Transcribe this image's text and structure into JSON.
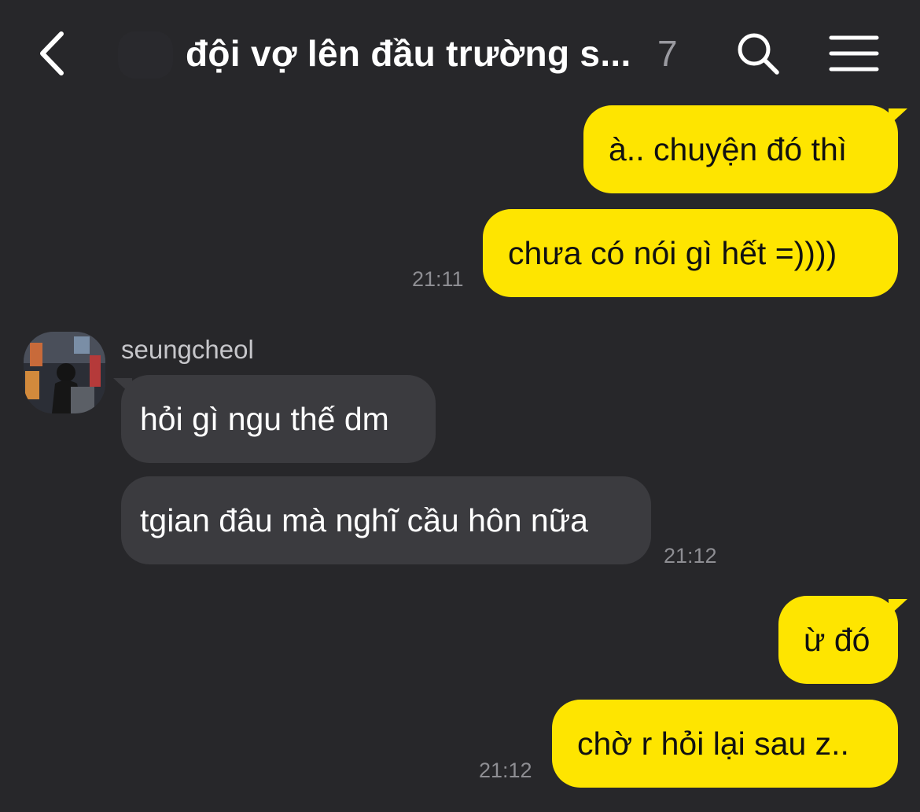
{
  "header": {
    "title": "đội vợ lên đầu trường s...",
    "member_count": "7",
    "back_icon": "chevron-left-icon",
    "search_icon": "search-icon",
    "menu_icon": "hamburger-menu-icon"
  },
  "messages": [
    {
      "sender": "me",
      "text": "à.. chuyện đó thì"
    },
    {
      "sender": "me",
      "text": "chưa có nói gì hết =))))",
      "time": "21:11"
    },
    {
      "sender": "seungcheol",
      "text": "hỏi gì ngu thế dm"
    },
    {
      "sender": "seungcheol",
      "text": "tgian đâu mà nghĩ cầu hôn nữa",
      "time": "21:12"
    },
    {
      "sender": "me",
      "text": "ừ đó"
    },
    {
      "sender": "me",
      "text": "chờ r hỏi lại sau z..",
      "time": "21:12"
    }
  ],
  "other_user": {
    "name": "seungcheol",
    "avatar_icon": "avatar-photo"
  },
  "colors": {
    "background": "#27272a",
    "my_bubble": "#fee500",
    "their_bubble": "#3b3b3f",
    "timestamp": "#8e8e93"
  }
}
